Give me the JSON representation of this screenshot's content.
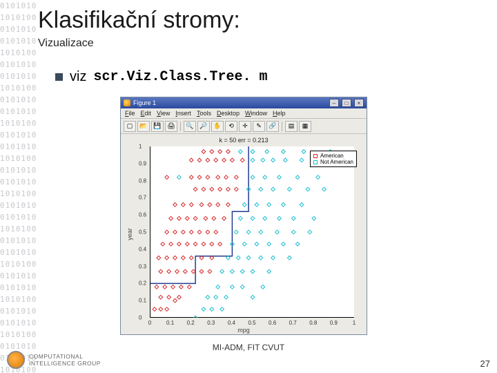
{
  "background_binary": "0101010\n1010100\n0101010\n0101010\n1010100\n0101010\n0101010\n1010100\n0101010\n0101010\n1010100\n0101010\n0101010\n1010100\n0101010\n0101010\n1010100\n0101010\n0101010\n1010100\n0101010\n0101010\n1010100\n0101010\n0101010\n1010100\n0101010\n0101010\n1010100\n0101010\n0101010\n1010100",
  "title": "Klasifikační stromy:",
  "subtitle": "Vizualizace",
  "bullet_text": "viz",
  "code_text": "scr.Viz.Class.Tree. m",
  "matlab": {
    "window_title": "Figure 1",
    "menu": {
      "file": "File",
      "edit": "Edit",
      "view": "View",
      "insert": "Insert",
      "tools": "Tools",
      "desktop": "Desktop",
      "window": "Window",
      "help": "Help"
    },
    "toolbar_icons": [
      "new",
      "open",
      "save",
      "print",
      "zoom-in",
      "zoom-out",
      "pan",
      "rotate",
      "data-cursor",
      "brush",
      "link",
      "colorbar",
      "legend"
    ]
  },
  "chart_data": {
    "type": "scatter",
    "title": "k = 50   err = 0.213",
    "xlabel": "mpg",
    "ylabel": "year",
    "xlim": [
      0,
      1
    ],
    "ylim": [
      0,
      1
    ],
    "xticks": [
      0,
      0.1,
      0.2,
      0.3,
      0.4,
      0.5,
      0.6,
      0.7,
      0.8,
      0.9,
      1
    ],
    "yticks": [
      0,
      0.1,
      0.2,
      0.3,
      0.4,
      0.5,
      0.6,
      0.7,
      0.8,
      0.9,
      1
    ],
    "legend": [
      {
        "name": "American",
        "color": "#d62728"
      },
      {
        "name": "Not American",
        "color": "#17becf"
      }
    ],
    "boundary_path": [
      [
        0,
        0.2
      ],
      [
        0.22,
        0.2
      ],
      [
        0.22,
        0.36
      ],
      [
        0.4,
        0.36
      ],
      [
        0.4,
        0.62
      ],
      [
        0.48,
        0.62
      ],
      [
        0.48,
        1.0
      ]
    ],
    "series": [
      {
        "name": "American",
        "color": "#d62728",
        "marker": "diamond",
        "points": [
          [
            0.02,
            0.05
          ],
          [
            0.05,
            0.05
          ],
          [
            0.08,
            0.05
          ],
          [
            0.12,
            0.1
          ],
          [
            0.05,
            0.12
          ],
          [
            0.09,
            0.12
          ],
          [
            0.14,
            0.12
          ],
          [
            0.03,
            0.18
          ],
          [
            0.07,
            0.18
          ],
          [
            0.11,
            0.18
          ],
          [
            0.15,
            0.18
          ],
          [
            0.19,
            0.18
          ],
          [
            0.05,
            0.27
          ],
          [
            0.09,
            0.27
          ],
          [
            0.13,
            0.27
          ],
          [
            0.17,
            0.27
          ],
          [
            0.21,
            0.27
          ],
          [
            0.25,
            0.27
          ],
          [
            0.29,
            0.27
          ],
          [
            0.04,
            0.35
          ],
          [
            0.08,
            0.35
          ],
          [
            0.12,
            0.35
          ],
          [
            0.16,
            0.35
          ],
          [
            0.2,
            0.35
          ],
          [
            0.25,
            0.35
          ],
          [
            0.3,
            0.35
          ],
          [
            0.06,
            0.43
          ],
          [
            0.1,
            0.43
          ],
          [
            0.14,
            0.43
          ],
          [
            0.18,
            0.43
          ],
          [
            0.22,
            0.43
          ],
          [
            0.26,
            0.43
          ],
          [
            0.3,
            0.43
          ],
          [
            0.34,
            0.43
          ],
          [
            0.08,
            0.5
          ],
          [
            0.12,
            0.5
          ],
          [
            0.16,
            0.5
          ],
          [
            0.2,
            0.5
          ],
          [
            0.24,
            0.5
          ],
          [
            0.28,
            0.5
          ],
          [
            0.32,
            0.5
          ],
          [
            0.1,
            0.58
          ],
          [
            0.14,
            0.58
          ],
          [
            0.18,
            0.58
          ],
          [
            0.22,
            0.58
          ],
          [
            0.27,
            0.58
          ],
          [
            0.31,
            0.58
          ],
          [
            0.36,
            0.58
          ],
          [
            0.12,
            0.66
          ],
          [
            0.16,
            0.66
          ],
          [
            0.2,
            0.66
          ],
          [
            0.25,
            0.66
          ],
          [
            0.29,
            0.66
          ],
          [
            0.33,
            0.66
          ],
          [
            0.38,
            0.66
          ],
          [
            0.22,
            0.75
          ],
          [
            0.26,
            0.75
          ],
          [
            0.3,
            0.75
          ],
          [
            0.34,
            0.75
          ],
          [
            0.38,
            0.75
          ],
          [
            0.42,
            0.75
          ],
          [
            0.08,
            0.82
          ],
          [
            0.2,
            0.82
          ],
          [
            0.24,
            0.82
          ],
          [
            0.28,
            0.82
          ],
          [
            0.33,
            0.82
          ],
          [
            0.37,
            0.82
          ],
          [
            0.42,
            0.82
          ],
          [
            0.2,
            0.92
          ],
          [
            0.24,
            0.92
          ],
          [
            0.28,
            0.92
          ],
          [
            0.32,
            0.92
          ],
          [
            0.36,
            0.92
          ],
          [
            0.4,
            0.92
          ],
          [
            0.45,
            0.92
          ],
          [
            0.26,
            0.97
          ],
          [
            0.3,
            0.97
          ],
          [
            0.34,
            0.97
          ],
          [
            0.38,
            0.97
          ]
        ]
      },
      {
        "name": "Not American",
        "color": "#17becf",
        "marker": "diamond",
        "points": [
          [
            0.22,
            0.0
          ],
          [
            0.26,
            0.05
          ],
          [
            0.3,
            0.05
          ],
          [
            0.35,
            0.05
          ],
          [
            0.28,
            0.12
          ],
          [
            0.32,
            0.12
          ],
          [
            0.37,
            0.12
          ],
          [
            0.5,
            0.12
          ],
          [
            0.33,
            0.18
          ],
          [
            0.4,
            0.18
          ],
          [
            0.45,
            0.18
          ],
          [
            0.55,
            0.18
          ],
          [
            0.35,
            0.27
          ],
          [
            0.4,
            0.27
          ],
          [
            0.45,
            0.27
          ],
          [
            0.5,
            0.27
          ],
          [
            0.58,
            0.27
          ],
          [
            0.38,
            0.35
          ],
          [
            0.43,
            0.35
          ],
          [
            0.48,
            0.35
          ],
          [
            0.54,
            0.35
          ],
          [
            0.6,
            0.35
          ],
          [
            0.68,
            0.35
          ],
          [
            0.4,
            0.43
          ],
          [
            0.46,
            0.43
          ],
          [
            0.52,
            0.43
          ],
          [
            0.58,
            0.43
          ],
          [
            0.65,
            0.43
          ],
          [
            0.72,
            0.43
          ],
          [
            0.42,
            0.5
          ],
          [
            0.48,
            0.5
          ],
          [
            0.54,
            0.5
          ],
          [
            0.62,
            0.5
          ],
          [
            0.7,
            0.5
          ],
          [
            0.78,
            0.5
          ],
          [
            0.44,
            0.58
          ],
          [
            0.5,
            0.58
          ],
          [
            0.56,
            0.58
          ],
          [
            0.63,
            0.58
          ],
          [
            0.7,
            0.58
          ],
          [
            0.8,
            0.58
          ],
          [
            0.46,
            0.66
          ],
          [
            0.52,
            0.66
          ],
          [
            0.58,
            0.66
          ],
          [
            0.65,
            0.66
          ],
          [
            0.74,
            0.66
          ],
          [
            0.48,
            0.75
          ],
          [
            0.54,
            0.75
          ],
          [
            0.6,
            0.75
          ],
          [
            0.68,
            0.75
          ],
          [
            0.77,
            0.75
          ],
          [
            0.85,
            0.75
          ],
          [
            0.14,
            0.82
          ],
          [
            0.5,
            0.82
          ],
          [
            0.56,
            0.82
          ],
          [
            0.63,
            0.82
          ],
          [
            0.72,
            0.82
          ],
          [
            0.82,
            0.82
          ],
          [
            0.5,
            0.92
          ],
          [
            0.55,
            0.92
          ],
          [
            0.6,
            0.92
          ],
          [
            0.66,
            0.92
          ],
          [
            0.74,
            0.92
          ],
          [
            0.84,
            0.92
          ],
          [
            0.95,
            0.92
          ],
          [
            0.44,
            0.97
          ],
          [
            0.5,
            0.97
          ],
          [
            0.57,
            0.97
          ],
          [
            0.65,
            0.97
          ],
          [
            0.75,
            0.97
          ],
          [
            0.88,
            0.97
          ]
        ]
      }
    ]
  },
  "footer": "MI-ADM, FIT CVUT",
  "logo_text_top": "COMPUTATIONAL",
  "logo_text_bot": "INTELLIGENCE GROUP",
  "page_number": "27"
}
